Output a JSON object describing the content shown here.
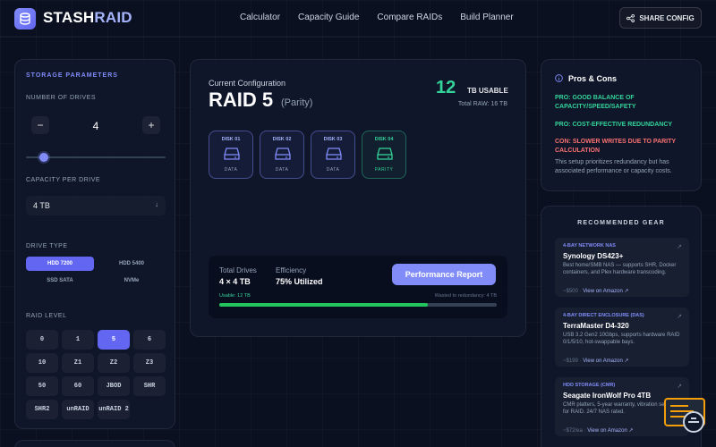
{
  "header": {
    "logo": {
      "part1": "STASH",
      "part2": "RAID"
    },
    "nav": [
      "Calculator",
      "Capacity Guide",
      "Compare RAIDs",
      "Build Planner"
    ],
    "share_label": "SHARE CONFIG"
  },
  "params": {
    "title": "STORAGE PARAMETERS",
    "num_drives_label": "NUMBER OF DRIVES",
    "minus": "−",
    "plus": "+",
    "num_drives": "4",
    "drive_slider_fraction": 0.13,
    "capacity_label": "CAPACITY PER DRIVE",
    "capacity_value": "4 TB",
    "drive_type_label": "DRIVE TYPE",
    "drive_types": [
      "HDD 7200",
      "HDD 5400",
      "SSD SATA",
      "NVMe"
    ],
    "drive_type_selected": "HDD 7200",
    "raid_label": "RAID LEVEL",
    "raid_levels": [
      "0",
      "1",
      "5",
      "6",
      "10",
      "Z1",
      "Z2",
      "Z3",
      "50",
      "60",
      "JBOD",
      "SHR",
      "SHR2",
      "unRAID",
      "unRAID 2"
    ],
    "raid_selected": "5"
  },
  "config": {
    "label": "Current Configuration",
    "title": "RAID 5",
    "subtitle": "(Parity)",
    "usable_num": "12",
    "usable_unit": "TB USABLE",
    "raw": "Total RAW: 16 TB",
    "disks": [
      {
        "label": "DISK 01",
        "role": "DATA"
      },
      {
        "label": "DISK 02",
        "role": "DATA"
      },
      {
        "label": "DISK 03",
        "role": "DATA"
      },
      {
        "label": "DISK 04",
        "role": "PARITY"
      }
    ],
    "total_label": "Total Drives",
    "total_value": "4 × 4 TB",
    "eff_label": "Efficiency",
    "eff_value": "75% Utilized",
    "perf_button": "Performance Report",
    "usable_bar_label": "Usable: 12 TB",
    "wasted_bar_label": "Wasted to redundancy: 4 TB",
    "usable_fraction": 0.75
  },
  "pros_cons": {
    "title": "Pros & Cons",
    "pros": [
      "PRO: GOOD BALANCE OF CAPACITY/SPEED/SAFETY",
      "PRO: COST-EFFECTIVE REDUNDANCY"
    ],
    "cons": [
      "CON: SLOWER WRITES DUE TO PARITY CALCULATION"
    ],
    "note": "This setup prioritizes redundancy but has associated performance or capacity costs."
  },
  "gear": {
    "title": "RECOMMENDED GEAR",
    "items": [
      {
        "category": "4-BAY NETWORK NAS",
        "name": "Synology DS423+",
        "desc": "Best home/SMB NAS — supports SHR, Docker containers, and Plex hardware transcoding.",
        "price": "~$500",
        "link": "View on Amazon ↗"
      },
      {
        "category": "4-BAY DIRECT ENCLOSURE (DAS)",
        "name": "TerraMaster D4-320",
        "desc": "USB 3.2 Gen2 10Gbps, supports hardware RAID 0/1/5/10, hot-swappable bays.",
        "price": "~$199",
        "link": "View on Amazon ↗"
      },
      {
        "category": "HDD STORAGE (CMR)",
        "name": "Seagate IronWolf Pro 4TB",
        "desc": "CMR platters, 5-year warranty, vibration sensors for RAID. 24/7 NAS rated.",
        "price": "~$72/ea",
        "link": "View on Amazon ↗"
      }
    ]
  },
  "colors": {
    "accent": "#818cf8",
    "good": "#34d399",
    "bad": "#f87171",
    "bg": "#0b1020"
  }
}
